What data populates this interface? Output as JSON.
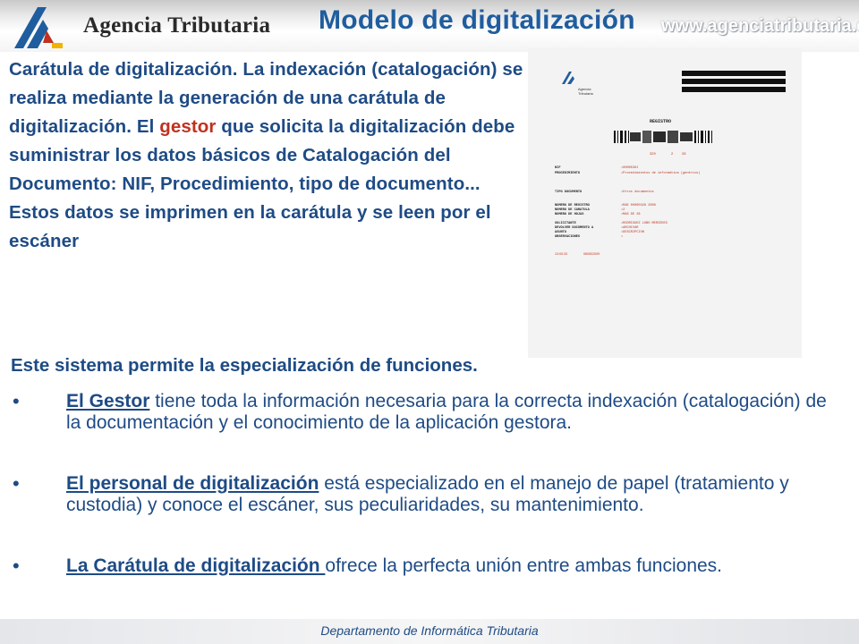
{
  "header": {
    "agency_name": "Agencia Tributaria",
    "title": "Modelo de digitalización",
    "url": "www.agenciatributaria.es"
  },
  "intro": {
    "part1_bold": "Carátula de digitalización.",
    "part2": " La indexación (catalogación) se realiza mediante la generación de una carátula de digitalización. El ",
    "accent": "gestor",
    "part3": " que solicita la digitalización debe suministrar los datos básicos de Catalogación del Documento: NIF, Procedimiento, tipo de documento... Estos datos se imprimen en la carátula y se leen por el escáner"
  },
  "document": {
    "logo_text_1": "Agencia",
    "logo_text_2": "Tributaria",
    "heading": "REGISTRO",
    "num_line": [
      "329",
      "2",
      "28"
    ],
    "fields": [
      {
        "label": "NIF",
        "value": "•0000530J"
      },
      {
        "label": "PROCEDIMIENTO",
        "value": "•Procedimientos de informática (genérico)"
      },
      {
        "label": "TIPO DOCUMENTO",
        "value": "•Otros documentos"
      },
      {
        "label": "NUMERO DE REGISTRO",
        "value": "•RAE 00000329 2008"
      },
      {
        "label": "NUMERO DE CARATULA",
        "value": "•2"
      },
      {
        "label": "NUMERO DE HOJAS",
        "value": "•MAS DE 28"
      },
      {
        "label": "SOLICITANTE",
        "value": "•RODRIGUEZ LOBO MERCEDES"
      },
      {
        "label": "DEVOLVER DOCUMENTO A",
        "value": "•ARCHIVAR"
      },
      {
        "label": "ASUNTO",
        "value": "•DESCRIPCION"
      },
      {
        "label": "OBSERVACIONES",
        "value": "•"
      }
    ],
    "time": "13:00:33",
    "date": "08/05/2009"
  },
  "subhead": "Este sistema permite la especialización de funciones.",
  "bullets": [
    {
      "marker": "•",
      "highlight": "El Gestor",
      "rest": " tiene toda la información necesaria para la correcta indexación (catalogación) de la documentación y el conocimiento de la aplicación gestora."
    },
    {
      "marker": "•",
      "highlight": "El personal de digitalización",
      "rest": " está especializado en el manejo de papel (tratamiento y custodia) y conoce el escáner, sus peculiaridades, su mantenimiento."
    },
    {
      "marker": "•",
      "highlight": "La Carátula de digitalización ",
      "rest": "ofrece la perfecta unión entre ambas funciones."
    }
  ],
  "footer": "Departamento de Informática Tributaria",
  "colors": {
    "title": "#1f5d9e",
    "body": "#1e4b85",
    "accent": "#c0311f"
  }
}
